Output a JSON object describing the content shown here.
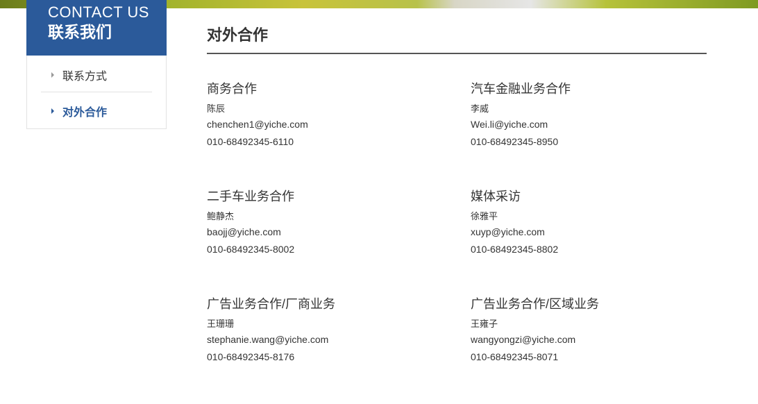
{
  "sidebar": {
    "header_en": "CONTACT US",
    "header_zh": "联系我们",
    "items": [
      {
        "label": "联系方式"
      },
      {
        "label": "对外合作"
      }
    ]
  },
  "main": {
    "title": "对外合作",
    "contacts": [
      {
        "title": "商务合作",
        "name": "陈辰",
        "email": "chenchen1@yiche.com",
        "phone": "010-68492345-6110"
      },
      {
        "title": "汽车金融业务合作",
        "name": "李威",
        "email": "Wei.li@yiche.com",
        "phone": "010-68492345-8950"
      },
      {
        "title": "二手车业务合作",
        "name": "鲍静杰",
        "email": "baojj@yiche.com",
        "phone": "010-68492345-8002"
      },
      {
        "title": "媒体采访",
        "name": "徐雅平",
        "email": "xuyp@yiche.com",
        "phone": "010-68492345-8802"
      },
      {
        "title": "广告业务合作/厂商业务",
        "name": "王珊珊",
        "email": "stephanie.wang@yiche.com",
        "phone": "010-68492345-8176"
      },
      {
        "title": "广告业务合作/区域业务",
        "name": "王雍子",
        "email": "wangyongzi@yiche.com",
        "phone": "010-68492345-8071"
      }
    ]
  },
  "colors": {
    "accent": "#2b5a9a",
    "text": "#333333",
    "rule": "#555555",
    "border": "#e2e2e2"
  }
}
